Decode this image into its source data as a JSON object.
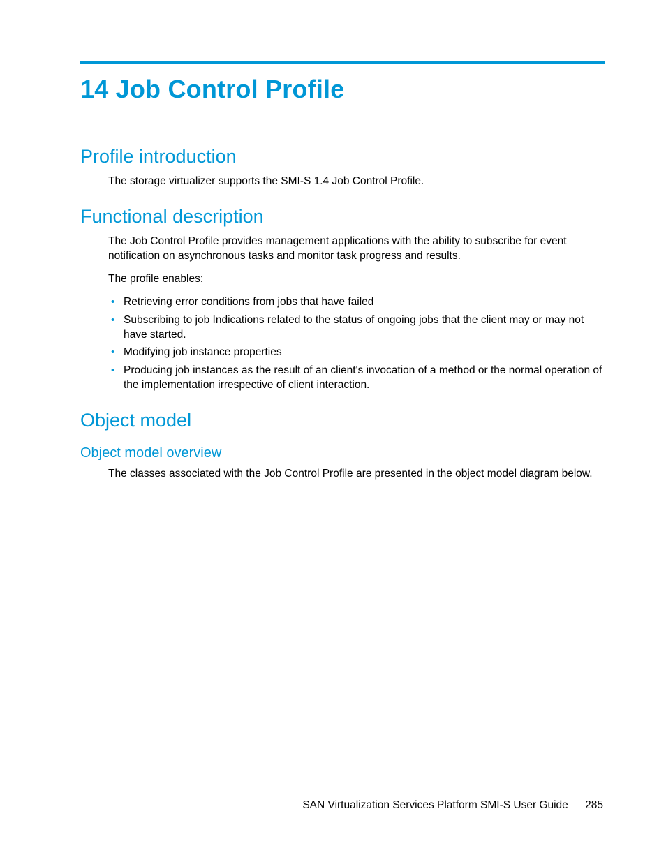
{
  "chapter": {
    "title": "14 Job Control Profile"
  },
  "sections": {
    "intro": {
      "heading": "Profile introduction",
      "body": "The storage virtualizer supports the SMI-S 1.4 Job Control Profile."
    },
    "func": {
      "heading": "Functional description",
      "body1": "The Job Control Profile provides management applications with the ability to subscribe for event notification on asynchronous tasks and monitor task progress and results.",
      "body2": "The profile enables:",
      "bullets": [
        "Retrieving error conditions from jobs that have failed",
        "Subscribing to job Indications related to the status of ongoing jobs that the client may or may not have started.",
        "Modifying job instance properties",
        "Producing job instances as the result of an client's invocation of a method or the normal operation of the implementation irrespective of client interaction."
      ]
    },
    "objmodel": {
      "heading": "Object model",
      "sub": {
        "heading": "Object model overview",
        "body": "The classes associated with the Job Control Profile are presented in the object model diagram below."
      }
    }
  },
  "footer": {
    "doc_title": "SAN Virtualization Services Platform SMI-S User Guide",
    "page_number": "285"
  }
}
